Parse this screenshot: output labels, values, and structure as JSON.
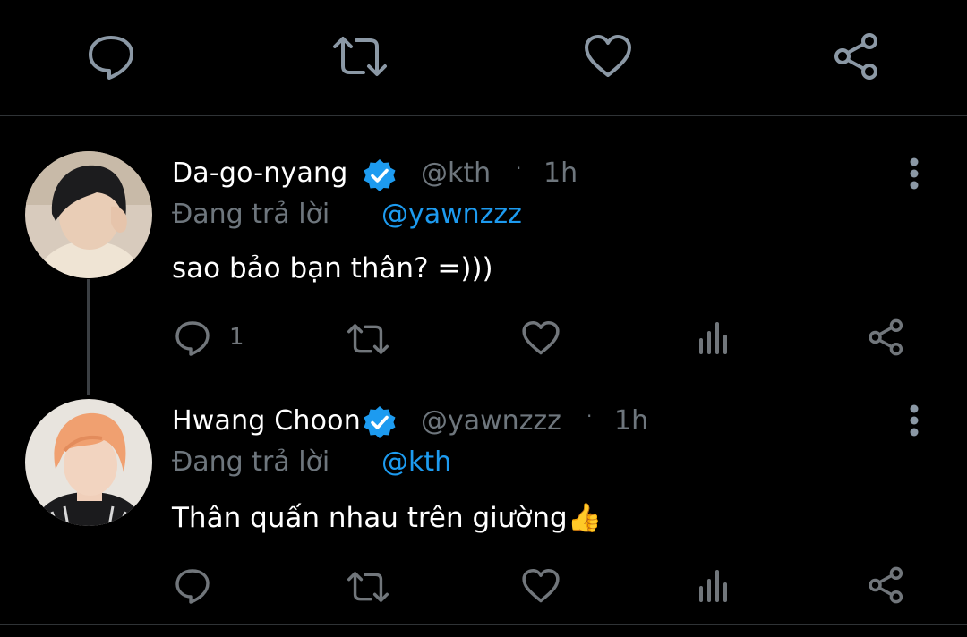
{
  "colors": {
    "background": "#000000",
    "primary_text": "#ffffff",
    "secondary_text": "#6e767d",
    "accent": "#1d9bf0",
    "divider": "#2f3336",
    "icon": "#71767b"
  },
  "top_actions": {
    "icons": [
      "comment-icon",
      "retweet-icon",
      "heart-icon",
      "share-icon"
    ]
  },
  "tweets": [
    {
      "display_name": "Da-go-nyang",
      "verified": true,
      "handle": "@kth",
      "separator": "·",
      "time": "1h",
      "reply_prefix": "Đang trả lời",
      "reply_to": "@yawnzzz",
      "text": "sao bảo bạn thân? =)))",
      "reply_count": "1",
      "avatar_hair_color": "#1c1c1e",
      "avatar_skin_color": "#e9cdb6"
    },
    {
      "display_name": "Hwang Choon",
      "verified": true,
      "handle": "@yawnzzz",
      "separator": "·",
      "time": "1h",
      "reply_prefix": "Đang trả lời",
      "reply_to": "@kth",
      "text": "Thân quấn nhau trên giường",
      "emoji": "👍",
      "reply_count": "",
      "avatar_hair_color": "#f0a070",
      "avatar_skin_color": "#f2d4c0"
    }
  ]
}
